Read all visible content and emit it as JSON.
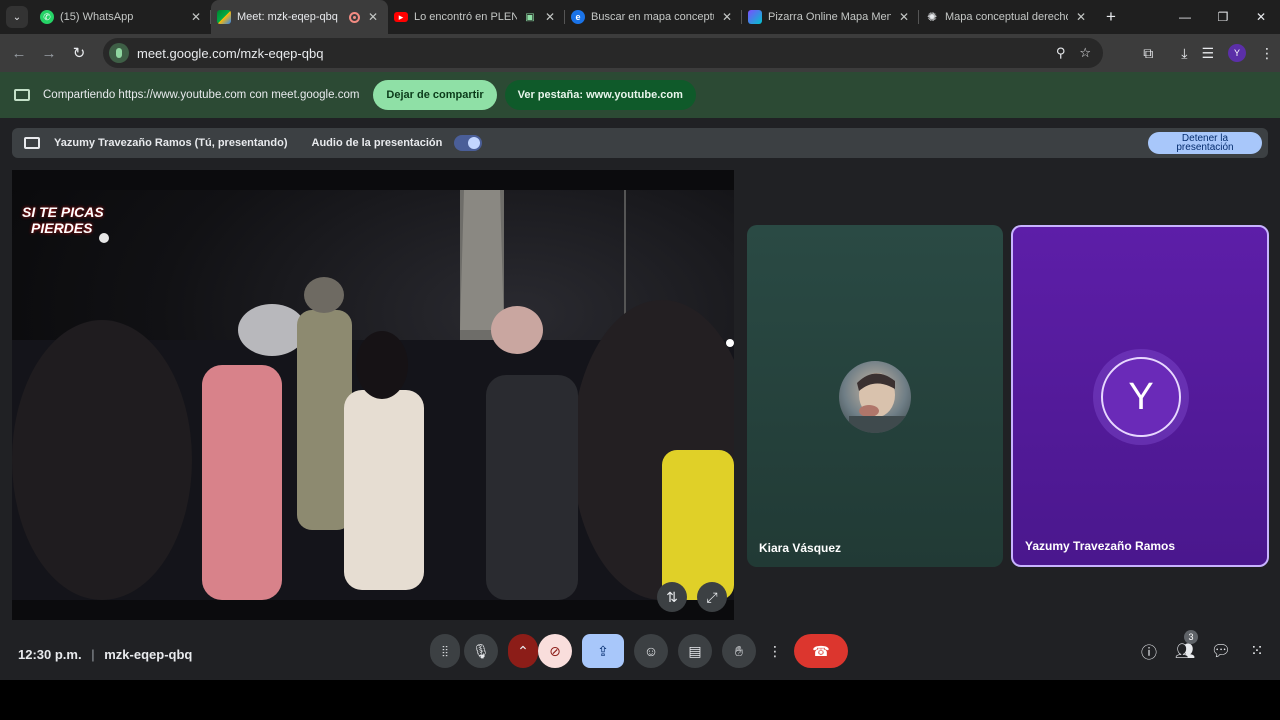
{
  "tabs": [
    {
      "title": "(15) WhatsApp",
      "favicon": "whatsapp-icon",
      "color": "#25d366"
    },
    {
      "title": "Meet: mzk-eqep-qbq",
      "favicon": "meet-icon",
      "color": "#00897b",
      "active": true
    },
    {
      "title": "Lo encontró en PLENO",
      "favicon": "youtube-icon",
      "color": "#ff0000"
    },
    {
      "title": "Buscar en mapa conceptual",
      "favicon": "edge-icon",
      "color": "#1a73e8"
    },
    {
      "title": "Pizarra Online Mapa Mental",
      "favicon": "canva-icon",
      "color": "#7c4dff"
    },
    {
      "title": "Mapa conceptual derecho",
      "favicon": "chatgpt-icon",
      "color": "#e8eaed"
    }
  ],
  "address": {
    "url": "meet.google.com/mzk-eqep-qbq"
  },
  "profile": {
    "initial": "Y"
  },
  "infobar": {
    "message": "Compartiendo https://www.youtube.com con meet.google.com",
    "stop_label": "Dejar de compartir",
    "view_label": "Ver pestaña: www.youtube.com"
  },
  "presenting": {
    "presenter": "Yazumy Travezaño Ramos (Tú, presentando)",
    "audio_label": "Audio de la presentación",
    "stop_label_1": "Detener la",
    "stop_label_2": "presentación"
  },
  "video": {
    "overlay_1": "SI TE PICAS",
    "overlay_2": "PIERDES"
  },
  "participants": [
    {
      "name": "Kiara Vásquez"
    },
    {
      "name": "Yazumy Travezaño Ramos",
      "initial": "Y"
    }
  ],
  "footer": {
    "time": "12:30 p.m.",
    "meeting_code": "mzk-eqep-qbq",
    "people_count": "3"
  }
}
